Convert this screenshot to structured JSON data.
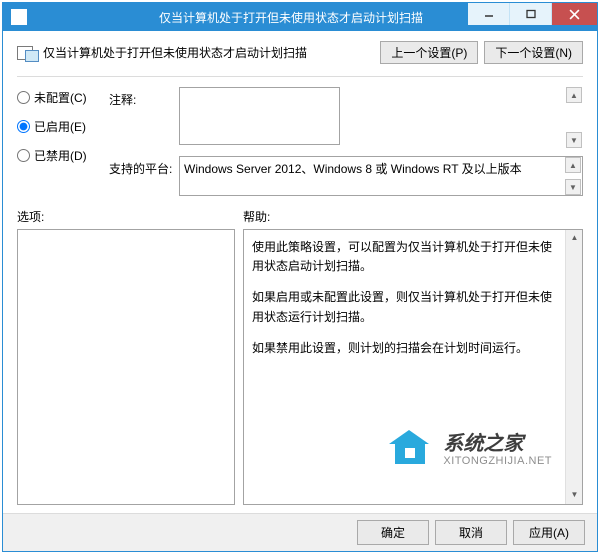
{
  "window": {
    "title": "仅当计算机处于打开但未使用状态才启动计划扫描"
  },
  "header": {
    "text": "仅当计算机处于打开但未使用状态才启动计划扫描"
  },
  "nav": {
    "prev": "上一个设置(P)",
    "next": "下一个设置(N)"
  },
  "radios": {
    "not_configured": "未配置(C)",
    "enabled": "已启用(E)",
    "disabled": "已禁用(D)",
    "selected": "enabled"
  },
  "fields": {
    "comment_label": "注释:",
    "comment_value": "",
    "platforms_label": "支持的平台:",
    "platforms_value": "Windows Server 2012、Windows 8 或 Windows RT 及以上版本"
  },
  "panels": {
    "options_label": "选项:",
    "help_label": "帮助:"
  },
  "help": {
    "p1": "使用此策略设置，可以配置为仅当计算机处于打开但未使用状态启动计划扫描。",
    "p2": "如果启用或未配置此设置，则仅当计算机处于打开但未使用状态运行计划扫描。",
    "p3": "如果禁用此设置，则计划的扫描会在计划时间运行。"
  },
  "footer": {
    "ok": "确定",
    "cancel": "取消",
    "apply": "应用(A)"
  },
  "watermark": {
    "brand": "系统之家",
    "url": "XITONGZHIJIA.NET"
  }
}
